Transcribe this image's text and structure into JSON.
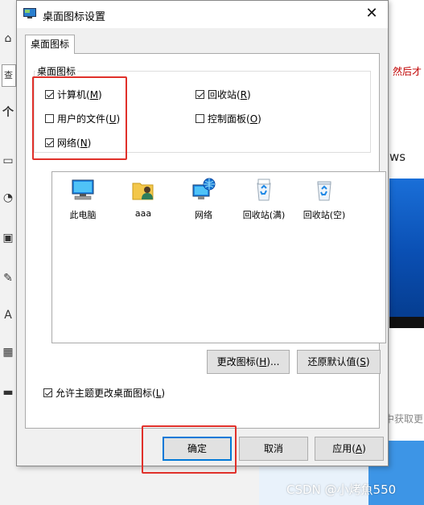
{
  "background": {
    "search_text": "查",
    "red_text": "然后才",
    "ws_text": "ws",
    "gray_text": "中获取更",
    "watermark": "CSDN @小烤魚550",
    "side_icons": [
      "home-icon",
      "picture-icon",
      "palette-icon",
      "monitor-icon",
      "pen-icon",
      "font-icon",
      "apps-icon",
      "taskbar-icon"
    ]
  },
  "dialog": {
    "title": "桌面图标设置",
    "close_glyph": "✕",
    "tab_label": "桌面图标",
    "group_label": "桌面图标",
    "checkboxes": [
      {
        "label": "计算机(",
        "key": "M",
        "suffix": ")",
        "checked": true
      },
      {
        "label": "回收站(",
        "key": "R",
        "suffix": ")",
        "checked": true
      },
      {
        "label": "用户的文件(",
        "key": "U",
        "suffix": ")",
        "checked": false
      },
      {
        "label": "控制面板(",
        "key": "O",
        "suffix": ")",
        "checked": false
      },
      {
        "label": "网络(",
        "key": "N",
        "suffix": ")",
        "checked": true
      }
    ],
    "icons": [
      {
        "label": "此电脑",
        "icon": "computer-icon"
      },
      {
        "label": "aaa",
        "icon": "user-folder-icon"
      },
      {
        "label": "网络",
        "icon": "network-icon"
      },
      {
        "label": "回收站(满)",
        "icon": "recycle-bin-full-icon"
      },
      {
        "label": "回收站(空)",
        "icon": "recycle-bin-empty-icon"
      }
    ],
    "change_icon_button": {
      "label": "更改图标(",
      "key": "H",
      "suffix": ")..."
    },
    "restore_default_button": {
      "label": "还原默认值(",
      "key": "S",
      "suffix": ")"
    },
    "allow_themes": {
      "label": "允许主题更改桌面图标(",
      "key": "L",
      "suffix": ")",
      "checked": true
    },
    "ok_button": "确定",
    "cancel_button": "取消",
    "apply_button": {
      "label": "应用(",
      "key": "A",
      "suffix": ")"
    }
  },
  "colors": {
    "highlight": "#e0302a",
    "accent": "#0078d7"
  }
}
